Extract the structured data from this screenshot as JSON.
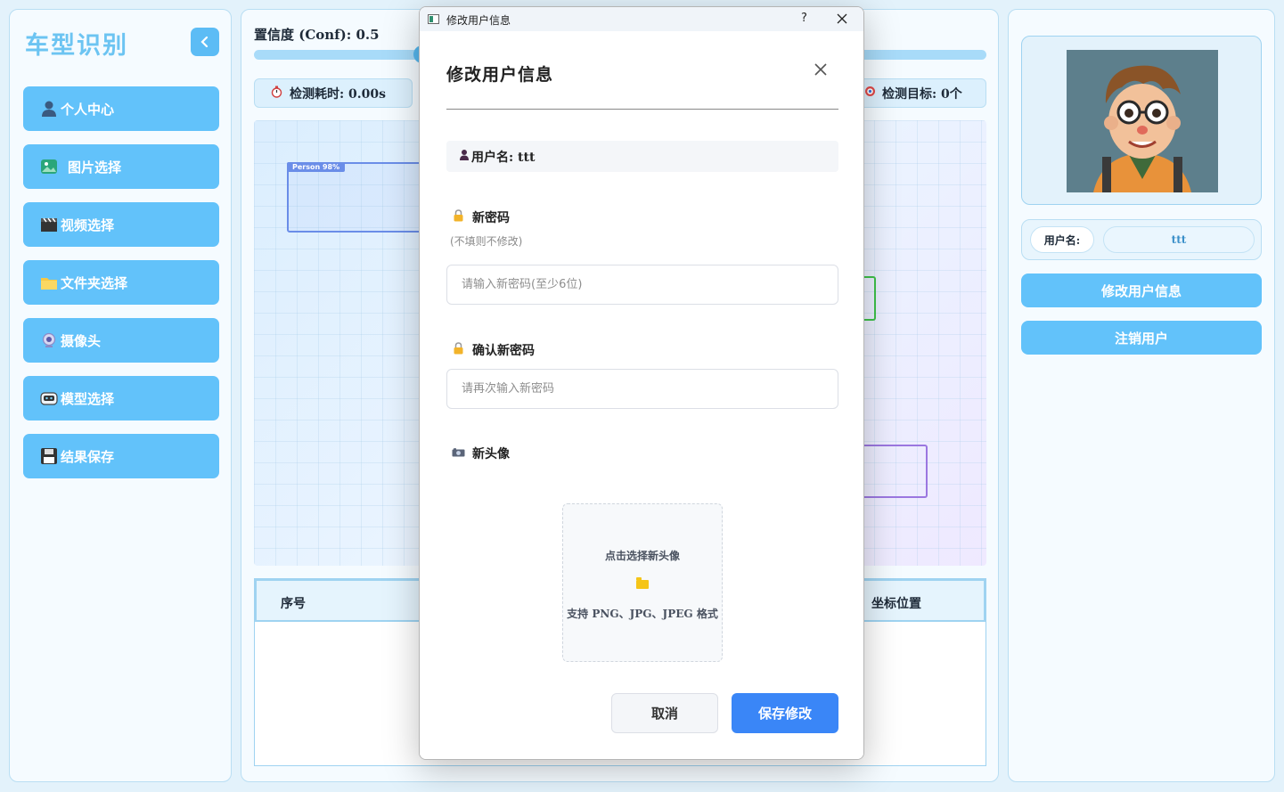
{
  "sidebar": {
    "title": "车型识别",
    "items": [
      {
        "label": "个人中心",
        "icon": "user-icon"
      },
      {
        "label": "图片选择",
        "icon": "image-icon"
      },
      {
        "label": "视频选择",
        "icon": "clapperboard-icon"
      },
      {
        "label": "文件夹选择",
        "icon": "folder-icon"
      },
      {
        "label": "摄像头",
        "icon": "webcam-icon"
      },
      {
        "label": "模型选择",
        "icon": "robot-icon"
      },
      {
        "label": "结果保存",
        "icon": "floppy-disk-icon"
      }
    ]
  },
  "main": {
    "conf_label": "置信度 (Conf): 0.5",
    "conf_value": 0.5,
    "time_label": "检测耗时: 0.00s",
    "target_label": "检测目标: 0个",
    "preview": {
      "detections": [
        {
          "tag": "Person 98%",
          "color": "#6a8de8"
        }
      ]
    },
    "table": {
      "columns": [
        "序号",
        "坐标位置"
      ]
    }
  },
  "right": {
    "username_label": "用户名:",
    "username_value": "ttt",
    "edit_button": "修改用户信息",
    "logout_button": "注销用户"
  },
  "dialog": {
    "window_title": "修改用户信息",
    "help": "?",
    "heading": "修改用户信息",
    "username_text": "用户名: ttt",
    "new_password_label": "新密码",
    "new_password_hint": "(不填则不修改)",
    "new_password_placeholder": "请输入新密码(至少6位)",
    "confirm_password_label": "确认新密码",
    "confirm_password_placeholder": "请再次输入新密码",
    "new_avatar_label": "新头像",
    "upload_title": "点击选择新头像",
    "upload_formats": "支持 PNG、JPG、JPEG 格式",
    "cancel": "取消",
    "save": "保存修改"
  },
  "colors": {
    "accent": "#62c2fa",
    "primary_button": "#3a86f7",
    "panel_border": "#b9def3"
  }
}
